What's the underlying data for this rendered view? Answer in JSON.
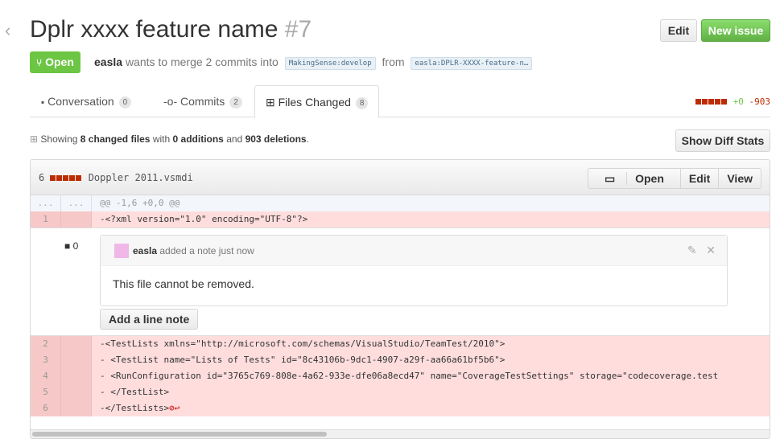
{
  "header": {
    "title": "Dplr xxxx feature name",
    "number": "#7",
    "edit_label": "Edit",
    "new_issue_label": "New issue"
  },
  "pr": {
    "state": "Open",
    "author": "easla",
    "merge_text": "wants to merge 2 commits into",
    "base_branch": "MakingSense:develop",
    "from_text": "from",
    "head_branch": "easla:DPLR-XXXX-feature-n…"
  },
  "tabs": [
    {
      "label": "Conversation",
      "count": "0"
    },
    {
      "label": "Commits",
      "count": "2"
    },
    {
      "label": "Files Changed",
      "count": "8"
    }
  ],
  "diffstat": {
    "additions": "+0",
    "deletions": "-903"
  },
  "toc": {
    "showing": "Showing",
    "files": "8 changed files",
    "with": "with",
    "additions": "0 additions",
    "and": "and",
    "deletions": "903 deletions",
    "end": ".",
    "show_stats_label": "Show Diff Stats"
  },
  "file": {
    "count": "6",
    "name": "Doppler 2011.vsmdi",
    "open_label": "Open",
    "edit_label": "Edit",
    "view_label": "View"
  },
  "hunk": {
    "ln1": "...",
    "ln2": "...",
    "text": "@@ -1,6 +0,0 @@"
  },
  "lines_top": [
    {
      "ln": "1",
      "text": "-<?xml version=\"1.0\" encoding=\"UTF-8\"?>"
    }
  ],
  "comment": {
    "count": "0",
    "user": "easla",
    "action": "added a note just now",
    "body": "This file cannot be removed.",
    "add_line_note": "Add a line note"
  },
  "lines_bottom": [
    {
      "ln": "2",
      "text": "-<TestLists xmlns=\"http://microsoft.com/schemas/VisualStudio/TeamTest/2010\">"
    },
    {
      "ln": "3",
      "text": "-  <TestList name=\"Lists of Tests\" id=\"8c43106b-9dc1-4907-a29f-aa66a61bf5b6\">"
    },
    {
      "ln": "4",
      "text": "-    <RunConfiguration id=\"3765c769-808e-4a62-933e-dfe06a8ecd47\" name=\"CoverageTestSettings\" storage=\"codecoverage.test"
    },
    {
      "ln": "5",
      "text": "-  </TestList>"
    },
    {
      "ln": "6",
      "text": "-</TestLists>"
    }
  ],
  "no_eol": "⊘↩"
}
